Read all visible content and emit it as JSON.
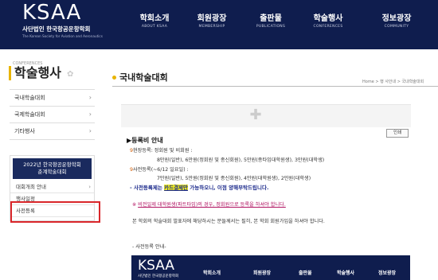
{
  "header": {
    "logo_big": "KSAA",
    "logo_ko": "사단법인 한국항공운항학회",
    "logo_en": "The Korean Society for Aviation and Aeronautics",
    "nav": [
      {
        "ko": "학회소개",
        "en": "ABOUT KSAA"
      },
      {
        "ko": "회원광장",
        "en": "MEMBERSHIP"
      },
      {
        "ko": "출판물",
        "en": "PUBLICATIONS"
      },
      {
        "ko": "학술행사",
        "en": "CONFERENCES"
      },
      {
        "ko": "정보광장",
        "en": "COMMUNITY"
      }
    ]
  },
  "sidebar": {
    "eyebrow": "CONFERENCES",
    "title": "학술행사",
    "items": [
      "국내학술대회",
      "국제학술대회",
      "기타행사"
    ],
    "box_title_1": "2022년 한국항공운항학회",
    "box_title_2": "춘계학술대회",
    "sub_items": [
      "대회개최 안내",
      "행사일정",
      "사전등록"
    ]
  },
  "content": {
    "title": "국내학술대회",
    "breadcrumb": "Home > 행 사안내 > 국내학술대회",
    "print_label": "인쇄",
    "section_title": "▶등록비 안내",
    "lines": {
      "l1": "현장등록: 정회원 및 비회원 :",
      "l2": "8만원(일반), 6만원(정회원 및 종신회원), 5만원(종타임대학원생), 3만원(대학생)",
      "l3": "사전등록(~6/12 일요일) :",
      "l4": "7만원(일반), 5만원(정회원 및 종신회원), 4만원(대학원생), 2만원(대학생)",
      "l5_a": "- 사전등록제는 ",
      "l5_hl": "카드결제만",
      "l5_b": " 가능하오니, 이점 양해부탁드립니다.",
      "l6_a": "※ ",
      "l6_u": "비전일제 대학원생(파트타임)의 경우, 정회원으로 등록을 하셔야 합니다.",
      "l7": "본 학회의 학술대회 발표자에 해당하시는 분들께서는 필히, 본 학회 회원가입을 하셔야 합니다.",
      "l8": "- 사전등록 안내-"
    }
  },
  "mini_header": {
    "logo": "KSAA",
    "logo_ko": "사단법인 한국항공운항학회",
    "nav": [
      "학회소개",
      "회원광장",
      "출판물",
      "학술행사",
      "정보광장"
    ]
  },
  "colors": {
    "navy": "#0f1d4e",
    "accent": "#e8b400",
    "highlight_red": "#d9262a"
  }
}
